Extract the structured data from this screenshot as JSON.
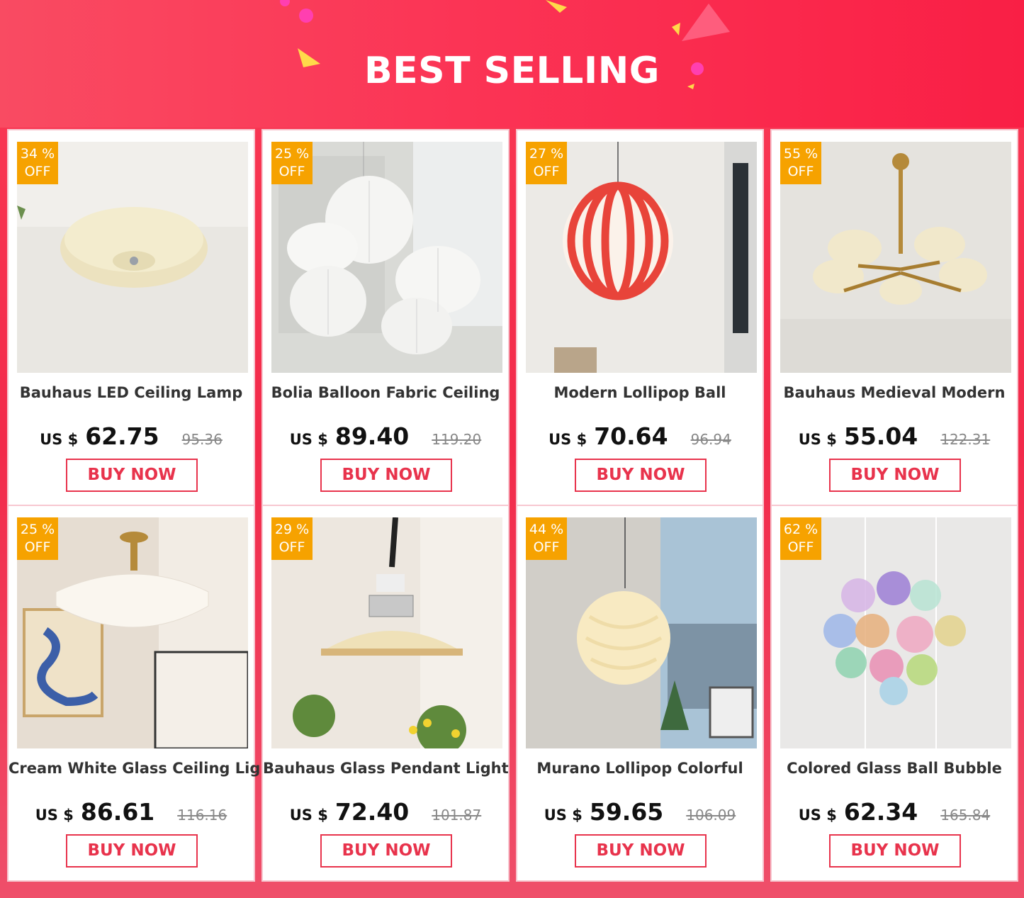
{
  "header": {
    "title": "BEST SELLING"
  },
  "colors": {
    "accent": "#e8334c",
    "badge": "#f6a200",
    "banner": "#fb3455"
  },
  "products": [
    {
      "discount": "34 %",
      "off": "OFF",
      "name": "Bauhaus LED Ceiling Lamp",
      "currency": "US $",
      "price": "62.75",
      "old_price": "95.36",
      "button": "BUY NOW",
      "image": "ceiling-lamp-image"
    },
    {
      "discount": "25 %",
      "off": "OFF",
      "name": "Bolia Balloon Fabric Ceiling",
      "currency": "US $",
      "price": "89.40",
      "old_price": "119.20",
      "button": "BUY NOW",
      "image": "balloon-lamp-image"
    },
    {
      "discount": "27 %",
      "off": "OFF",
      "name": "Modern Lollipop Ball",
      "currency": "US $",
      "price": "70.64",
      "old_price": "96.94",
      "button": "BUY NOW",
      "image": "lollipop-ball-image"
    },
    {
      "discount": "55 %",
      "off": "OFF",
      "name": "Bauhaus Medieval Modern",
      "currency": "US $",
      "price": "55.04",
      "old_price": "122.31",
      "button": "BUY NOW",
      "image": "chandelier-image"
    },
    {
      "discount": "25 %",
      "off": "OFF",
      "name": "Cream White Glass Ceiling Light",
      "currency": "US $",
      "price": "86.61",
      "old_price": "116.16",
      "button": "BUY NOW",
      "image": "cream-glass-image"
    },
    {
      "discount": "29 %",
      "off": "OFF",
      "name": "Bauhaus Glass Pendant Light",
      "currency": "US $",
      "price": "72.40",
      "old_price": "101.87",
      "button": "BUY NOW",
      "image": "pendant-light-image"
    },
    {
      "discount": "44 %",
      "off": "OFF",
      "name": "Murano Lollipop Colorful",
      "currency": "US $",
      "price": "59.65",
      "old_price": "106.09",
      "button": "BUY NOW",
      "image": "murano-ball-image"
    },
    {
      "discount": "62 %",
      "off": "OFF",
      "name": "Colored Glass Ball Bubble",
      "currency": "US $",
      "price": "62.34",
      "old_price": "165.84",
      "button": "BUY NOW",
      "image": "bubble-light-image"
    }
  ]
}
